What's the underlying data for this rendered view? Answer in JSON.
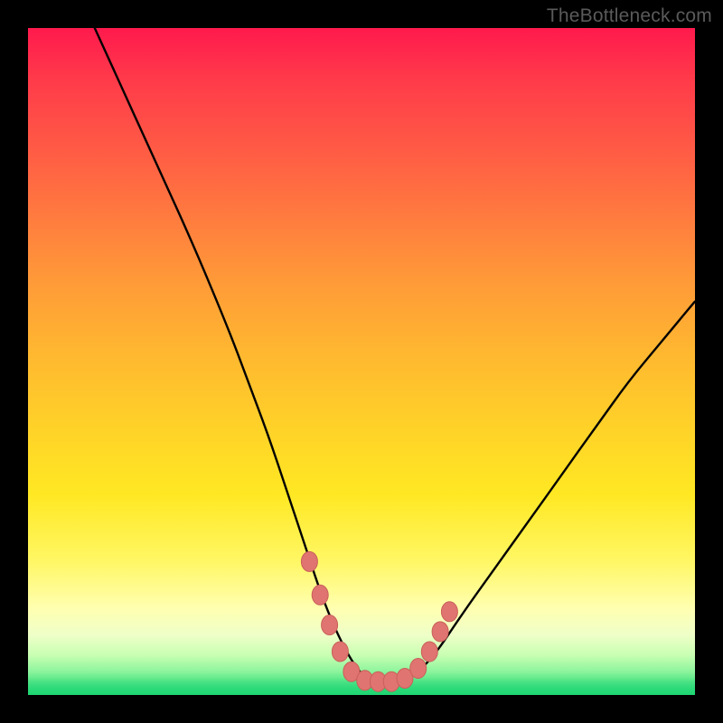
{
  "watermark": {
    "text": "TheBottleneck.com"
  },
  "colors": {
    "curve_stroke": "#000000",
    "marker_fill": "#e07470",
    "marker_stroke": "#c9605a",
    "frame_bg": "#000000",
    "gradient_top": "#ff1a4d",
    "gradient_bottom": "#1ed672"
  },
  "chart_data": {
    "type": "line",
    "title": "",
    "xlabel": "",
    "ylabel": "",
    "xlim": [
      0,
      100
    ],
    "ylim": [
      0,
      100
    ],
    "grid": false,
    "legend": false,
    "series": [
      {
        "name": "curve",
        "x": [
          10,
          15,
          20,
          25,
          30,
          33,
          36,
          39,
          42,
          44,
          46,
          48,
          50,
          52,
          54,
          56,
          58,
          61,
          65,
          70,
          75,
          80,
          85,
          90,
          95,
          100
        ],
        "y": [
          100,
          89,
          78,
          67,
          55,
          47,
          39,
          30,
          21,
          15,
          10,
          6,
          3,
          2,
          2,
          2,
          3,
          6,
          12,
          19,
          26,
          33,
          40,
          47,
          53,
          59
        ]
      }
    ],
    "markers": [
      {
        "x": 42.2,
        "y": 20.0
      },
      {
        "x": 43.8,
        "y": 15.0
      },
      {
        "x": 45.2,
        "y": 10.5
      },
      {
        "x": 46.8,
        "y": 6.5
      },
      {
        "x": 48.5,
        "y": 3.5
      },
      {
        "x": 50.5,
        "y": 2.2
      },
      {
        "x": 52.5,
        "y": 2.0
      },
      {
        "x": 54.5,
        "y": 2.0
      },
      {
        "x": 56.5,
        "y": 2.5
      },
      {
        "x": 58.5,
        "y": 4.0
      },
      {
        "x": 60.2,
        "y": 6.5
      },
      {
        "x": 61.8,
        "y": 9.5
      },
      {
        "x": 63.2,
        "y": 12.5
      }
    ]
  }
}
